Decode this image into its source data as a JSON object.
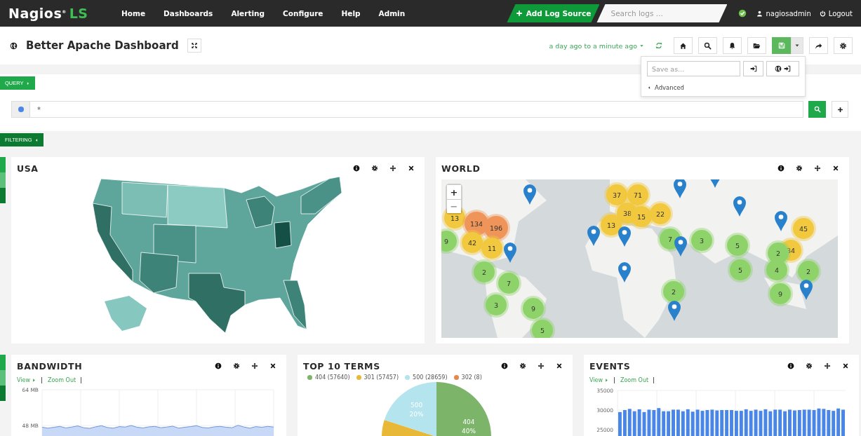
{
  "nav": {
    "logo": {
      "name": "Nagios$^{®}$",
      "suffix": "LS"
    },
    "menu": [
      {
        "label": "Home"
      },
      {
        "label": "Dashboards"
      },
      {
        "label": "Alerting"
      },
      {
        "label": "Configure"
      },
      {
        "label": "Help"
      },
      {
        "label": "Admin"
      }
    ],
    "add_button": "Add Log Source",
    "search": {
      "placeholder": "Search logs ..."
    },
    "user": "nagiosadmin",
    "logout": "Logout"
  },
  "dashboard": {
    "title": "Better Apache Dashboard",
    "time_range": "a day ago to a minute ago",
    "toolbar": [
      {
        "kind": "home",
        "open": false
      },
      {
        "kind": "search",
        "open": false
      },
      {
        "kind": "bell",
        "open": false
      },
      {
        "kind": "folder",
        "open": false
      },
      {
        "kind": "save",
        "open": true
      },
      {
        "kind": "share",
        "open": false
      },
      {
        "kind": "settings",
        "open": false
      }
    ],
    "save_menu": {
      "placeholder": "Save as...",
      "advanced": "Advanced"
    }
  },
  "query": {
    "tab": "QUERY",
    "value": "*"
  },
  "filtering": {
    "tab": "FILTERING"
  },
  "panels": [
    {
      "title": "USA",
      "kind": "usa_map"
    },
    {
      "title": "WORLD",
      "kind": "world_map",
      "zoom": [
        "+",
        "−"
      ],
      "markers": [
        {
          "kind": "cluster",
          "count": "37",
          "color": "#f1c83e"
        },
        {
          "kind": "cluster",
          "count": "71",
          "color": "#f1c83e"
        },
        {
          "kind": "cluster",
          "count": "38",
          "color": "#f1c83e"
        },
        {
          "kind": "cluster",
          "count": "15",
          "color": "#f1c83e"
        },
        {
          "kind": "cluster",
          "count": "22",
          "color": "#f1c83e"
        },
        {
          "kind": "cluster",
          "count": "13",
          "color": "#f1c83e"
        },
        {
          "kind": "cluster",
          "count": "13",
          "color": "#f1c83e"
        },
        {
          "kind": "cluster",
          "count": "134",
          "color": "#f0955a"
        },
        {
          "kind": "cluster",
          "count": "196",
          "color": "#f0955a"
        },
        {
          "kind": "cluster",
          "count": "42",
          "color": "#f1c83e"
        },
        {
          "kind": "cluster",
          "count": "11",
          "color": "#f1c83e"
        },
        {
          "kind": "cluster",
          "count": "9",
          "color": "#8ed36a"
        },
        {
          "kind": "cluster",
          "count": "2",
          "color": "#8ed36a"
        },
        {
          "kind": "cluster",
          "count": "7",
          "color": "#8ed36a"
        },
        {
          "kind": "cluster",
          "count": "3",
          "color": "#8ed36a"
        },
        {
          "kind": "cluster",
          "count": "9",
          "color": "#8ed36a"
        },
        {
          "kind": "cluster",
          "count": "5",
          "color": "#8ed36a"
        },
        {
          "kind": "cluster",
          "count": "7",
          "color": "#8ed36a"
        },
        {
          "kind": "cluster",
          "count": "3",
          "color": "#8ed36a"
        },
        {
          "kind": "cluster",
          "count": "5",
          "color": "#8ed36a"
        },
        {
          "kind": "cluster",
          "count": "5",
          "color": "#8ed36a"
        },
        {
          "kind": "cluster",
          "count": "2",
          "color": "#8ed36a"
        },
        {
          "kind": "cluster",
          "count": "34",
          "color": "#f1c83e"
        },
        {
          "kind": "cluster",
          "count": "2",
          "color": "#8ed36a"
        },
        {
          "kind": "cluster",
          "count": "45",
          "color": "#f1c83e"
        },
        {
          "kind": "cluster",
          "count": "4",
          "color": "#8ed36a"
        },
        {
          "kind": "cluster",
          "count": "2",
          "color": "#8ed36a"
        },
        {
          "kind": "cluster",
          "count": "9",
          "color": "#8ed36a"
        },
        {
          "kind": "pin"
        },
        {
          "kind": "pin"
        },
        {
          "kind": "pin"
        },
        {
          "kind": "pin"
        },
        {
          "kind": "pin"
        },
        {
          "kind": "pin"
        },
        {
          "kind": "pin"
        },
        {
          "kind": "pin"
        },
        {
          "kind": "pin"
        },
        {
          "kind": "pin"
        },
        {
          "kind": "pin"
        },
        {
          "kind": "pin"
        }
      ]
    },
    {
      "title": "BANDWIDTH",
      "kind": "chart",
      "links": [
        "View",
        "Zoom Out"
      ],
      "chart_data": {
        "type": "area",
        "grid": true,
        "ylim": [
          0,
          64
        ],
        "yticks": [
          {
            "value": 64,
            "label": "64 MB"
          },
          {
            "value": 48,
            "label": "48 MB"
          }
        ],
        "values": [
          47.2,
          46.8,
          47.2,
          47.6,
          46.9,
          47.3,
          47.8,
          47.0,
          46.7,
          47.4,
          47.9,
          47.1,
          46.8,
          47.5,
          47.3,
          48.0,
          47.2,
          46.9,
          47.4,
          47.6,
          47.0,
          47.3,
          47.7,
          46.8,
          47.2,
          47.5,
          47.9,
          47.1,
          46.9,
          47.4,
          47.6,
          47.2,
          47.0,
          48.1,
          47.3,
          46.8,
          47.5,
          47.2,
          47.6,
          47.3
        ]
      }
    },
    {
      "title": "TOP 10 TERMS",
      "kind": "chart",
      "legend": [
        {
          "count": "(57640)",
          "color": "#7cb46a"
        },
        {
          "count": "(57457)",
          "color": "#e8b838"
        },
        {
          "count": "(28659)",
          "color": "#b4e4ee"
        },
        {
          "count": "(8)",
          "color": "#e8854a"
        }
      ],
      "chart_data": {
        "type": "pie",
        "categories": [
          "404",
          "301",
          "500",
          "302"
        ],
        "values": [
          40,
          40,
          20,
          0
        ],
        "value_labels": [
          "40%",
          null,
          "20%",
          null
        ]
      }
    },
    {
      "title": "EVENTS",
      "kind": "chart",
      "links": [
        "View",
        "Zoom Out"
      ],
      "chart_data": {
        "type": "bar",
        "grid": true,
        "ylim": [
          0,
          35000
        ],
        "yticks": [
          35000,
          30000,
          25000
        ],
        "values": [
          29500,
          30000,
          30300,
          29700,
          30200,
          29500,
          30100,
          30000,
          30500,
          29700,
          29700,
          30100,
          30100,
          29700,
          30200,
          29600,
          30100,
          29800,
          30000,
          30100,
          29900,
          30000,
          30000,
          30000,
          29800,
          29800,
          30200,
          29800,
          30100,
          29800,
          30200,
          29700,
          30100,
          30100,
          29700,
          30100,
          29900,
          30000,
          30100,
          30100,
          30000,
          30400,
          30300,
          30000,
          29800,
          30400,
          30100
        ]
      }
    }
  ]
}
